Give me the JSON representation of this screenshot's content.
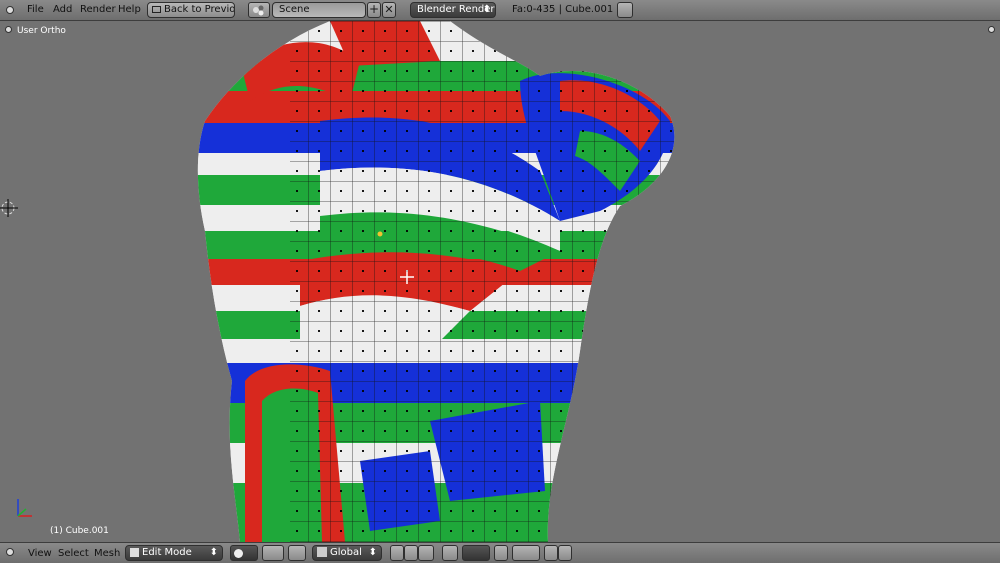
{
  "top_menu": {
    "file": "File",
    "add": "Add",
    "render": "Render",
    "help": "Help"
  },
  "back_button": "Back to Previous",
  "scene": "Scene",
  "render_engine": "Blender Render",
  "stats": "Fa:0-435 | Cube.001",
  "viewport": {
    "view_name": "User Ortho",
    "object_name": "(1) Cube.001"
  },
  "bottom_menu": {
    "view": "View",
    "select": "Select",
    "mesh": "Mesh"
  },
  "mode": "Edit Mode",
  "orientation": "Global",
  "colors": {
    "red": "#d8281e",
    "green": "#1fa83a",
    "blue": "#1530d8",
    "white": "#eeeeee"
  }
}
